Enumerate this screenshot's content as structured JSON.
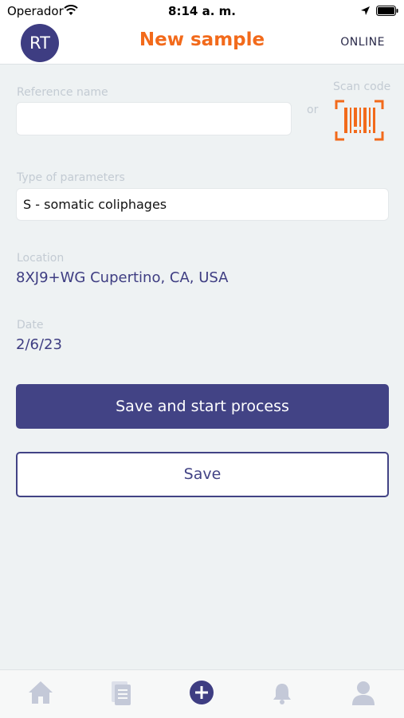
{
  "status_bar": {
    "carrier": "Operador",
    "time": "8:14 a. m."
  },
  "header": {
    "avatar_initials": "RT",
    "title": "New sample",
    "connection_status": "ONLINE"
  },
  "form": {
    "reference_name": {
      "label": "Reference name",
      "value": "",
      "placeholder": ""
    },
    "or_text": "or",
    "scan_code_label": "Scan code",
    "parameters": {
      "label": "Type of parameters",
      "value": "S - somatic coliphages"
    },
    "location": {
      "label": "Location",
      "value": "8XJ9+WG Cupertino, CA, USA"
    },
    "date": {
      "label": "Date",
      "value": "2/6/23"
    }
  },
  "actions": {
    "primary_label": "Save and start process",
    "secondary_label": "Save"
  },
  "tab_bar": [
    "home-icon",
    "documents-icon",
    "add-icon",
    "bell-icon",
    "profile-icon"
  ],
  "colors": {
    "accent": "#f26a1b",
    "primary": "#424385",
    "muted_icon": "#c4c9d8"
  }
}
